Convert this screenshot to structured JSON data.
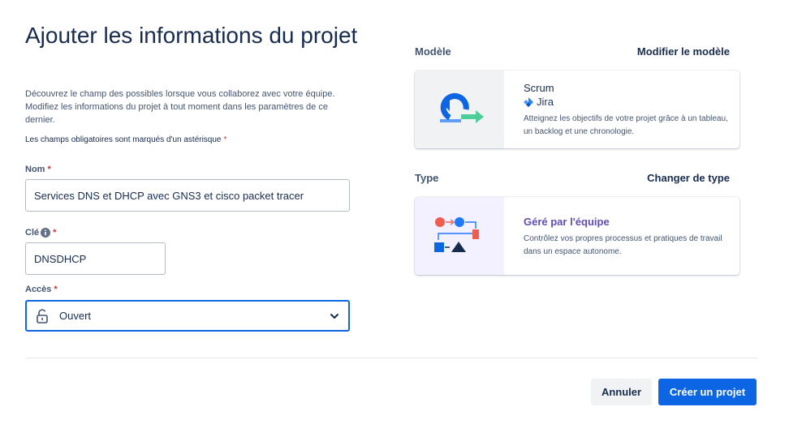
{
  "page": {
    "title": "Ajouter les informations du projet",
    "intro": "Découvrez le champ des possibles lorsque vous collaborez avec votre équipe. Modifiez les informations du projet à tout moment dans les paramètres de ce dernier.",
    "required_note": "Les champs obligatoires sont marqués d'un astérisque",
    "required_mark": "*"
  },
  "form": {
    "name": {
      "label": "Nom",
      "value": "Services DNS et DHCP avec GNS3 et cisco packet tracer"
    },
    "key": {
      "label": "Clé",
      "value": "DNSDHCP",
      "info_icon": "info-icon"
    },
    "access": {
      "label": "Accès",
      "value": "Ouvert",
      "icon": "lock-open-icon"
    }
  },
  "template": {
    "section_label": "Modèle",
    "action": "Modifier le modèle",
    "card": {
      "title": "Scrum",
      "product": "Jira",
      "description": "Atteignez les objectifs de votre projet grâce à un tableau, un backlog et une chronologie."
    }
  },
  "type": {
    "section_label": "Type",
    "action": "Changer de type",
    "card": {
      "title": "Géré par l'équipe",
      "description": "Contrôlez vos propres processus et pratiques de travail dans un espace autonome."
    }
  },
  "footer": {
    "cancel": "Annuler",
    "create": "Créer un projet"
  },
  "colors": {
    "primary": "#0C66E4",
    "required": "#C9372C",
    "team_managed_title": "#5E4DB2"
  }
}
